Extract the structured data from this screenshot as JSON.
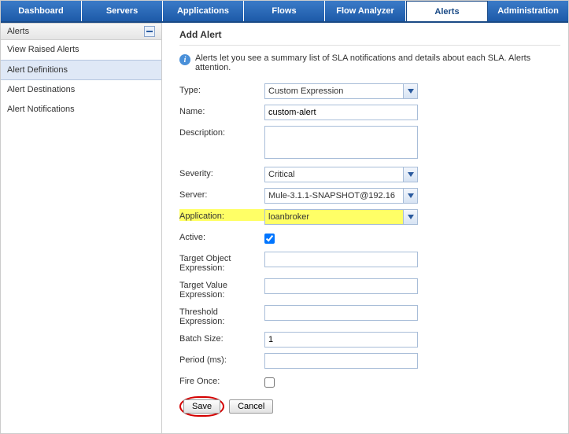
{
  "nav": {
    "tabs": [
      "Dashboard",
      "Servers",
      "Applications",
      "Flows",
      "Flow Analyzer",
      "Alerts",
      "Administration"
    ],
    "active_index": 5
  },
  "sidebar": {
    "title": "Alerts",
    "items": [
      "View Raised Alerts",
      "Alert Definitions",
      "Alert Destinations",
      "Alert Notifications"
    ],
    "selected_index": 1
  },
  "page": {
    "title": "Add Alert",
    "info": "Alerts let you see a summary list of SLA notifications and details about each SLA. Alerts attention."
  },
  "form": {
    "type_label": "Type:",
    "type_value": "Custom Expression",
    "name_label": "Name:",
    "name_value": "custom-alert",
    "description_label": "Description:",
    "description_value": "",
    "severity_label": "Severity:",
    "severity_value": "Critical",
    "server_label": "Server:",
    "server_value": "Mule-3.1.1-SNAPSHOT@192.16",
    "application_label": "Application:",
    "application_value": "loanbroker",
    "active_label": "Active:",
    "active_checked": true,
    "target_object_label": "Target Object Expression:",
    "target_object_value": "",
    "target_value_label": "Target Value Expression:",
    "target_value_value": "",
    "threshold_label": "Threshold Expression:",
    "threshold_value": "",
    "batch_size_label": "Batch Size:",
    "batch_size_value": "1",
    "period_label": "Period (ms):",
    "period_value": "",
    "fire_once_label": "Fire Once:",
    "fire_once_checked": false
  },
  "buttons": {
    "save": "Save",
    "cancel": "Cancel"
  }
}
